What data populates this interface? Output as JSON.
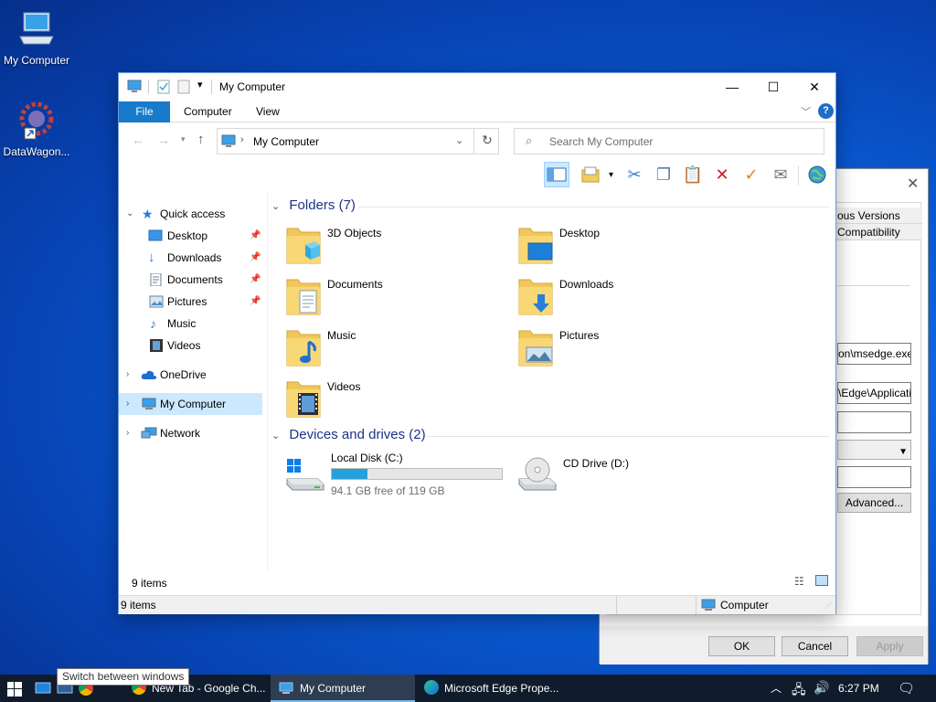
{
  "desktop": {
    "icons": [
      {
        "label": "My Computer"
      },
      {
        "label": "DataWagon..."
      }
    ]
  },
  "props_window": {
    "tab_previous_versions": "ous Versions",
    "tab_compatibility": "Compatibility",
    "target_field": "on\\msedge.exe\"",
    "start_in_field": "\\Edge\\Applicatio",
    "shortcut_field": "",
    "run_field": "",
    "comment_field": "",
    "advanced_button": "Advanced...",
    "ok_button": "OK",
    "cancel_button": "Cancel",
    "apply_button": "Apply"
  },
  "explorer": {
    "title": "My Computer",
    "ribbon_tabs": [
      "File",
      "Computer",
      "View"
    ],
    "address": "My Computer",
    "search_placeholder": "Search My Computer",
    "nav": {
      "quick_access": "Quick access",
      "items": [
        "Desktop",
        "Downloads",
        "Documents",
        "Pictures",
        "Music",
        "Videos"
      ],
      "onedrive": "OneDrive",
      "my_computer": "My Computer",
      "network": "Network"
    },
    "folders_header": "Folders (7)",
    "folders": [
      "3D Objects",
      "Desktop",
      "Documents",
      "Downloads",
      "Music",
      "Pictures",
      "Videos"
    ],
    "devices_header": "Devices and drives (2)",
    "drives": [
      {
        "name": "Local Disk (C:)",
        "free_text": "94.1 GB free of 119 GB",
        "used_fraction": 0.21
      },
      {
        "name": "CD Drive (D:)"
      }
    ],
    "status_items": "9 items",
    "footer_items": "9 items",
    "footer_location": "Computer"
  },
  "taskbar": {
    "tooltip": "Switch between windows",
    "tasks": [
      "New Tab - Google Ch...",
      "My Computer",
      "Microsoft Edge Prope..."
    ],
    "time": "6:27 PM"
  }
}
